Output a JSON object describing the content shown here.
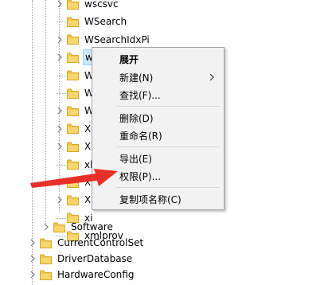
{
  "tree": {
    "children_of_services": [
      {
        "label": "wscsvc",
        "expandable": true
      },
      {
        "label": "WSearch",
        "expandable": false
      },
      {
        "label": "WSearchIdxPi",
        "expandable": true
      },
      {
        "label": "w",
        "expandable": true,
        "selected": true
      },
      {
        "label": "W",
        "expandable": false
      },
      {
        "label": "W",
        "expandable": false
      },
      {
        "label": "W",
        "expandable": true
      },
      {
        "label": "X",
        "expandable": true
      },
      {
        "label": "X",
        "expandable": true
      },
      {
        "label": "xb",
        "expandable": false
      },
      {
        "label": "X",
        "expandable": true
      },
      {
        "label": "X",
        "expandable": true
      },
      {
        "label": "xi",
        "expandable": false
      },
      {
        "label": "xmlprov",
        "expandable": false
      }
    ],
    "top_level": [
      {
        "label": "Software",
        "expandable": true,
        "indent": 1
      },
      {
        "label": "CurrentControlSet",
        "expandable": true,
        "indent": 0
      },
      {
        "label": "DriverDatabase",
        "expandable": true,
        "indent": 0
      },
      {
        "label": "HardwareConfig",
        "expandable": true,
        "indent": 0
      }
    ]
  },
  "context_menu": {
    "expand": "展开",
    "new": "新建(N)",
    "find": "查找(F)...",
    "delete": "删除(D)",
    "rename": "重命名(R)",
    "export": "导出(E)",
    "permissions": "权限(P)...",
    "copy_key_name": "复制项名称(C)"
  },
  "colors": {
    "folder": "#f3c94e",
    "selection": "#cce8ff",
    "arrow": "#e8302a"
  }
}
